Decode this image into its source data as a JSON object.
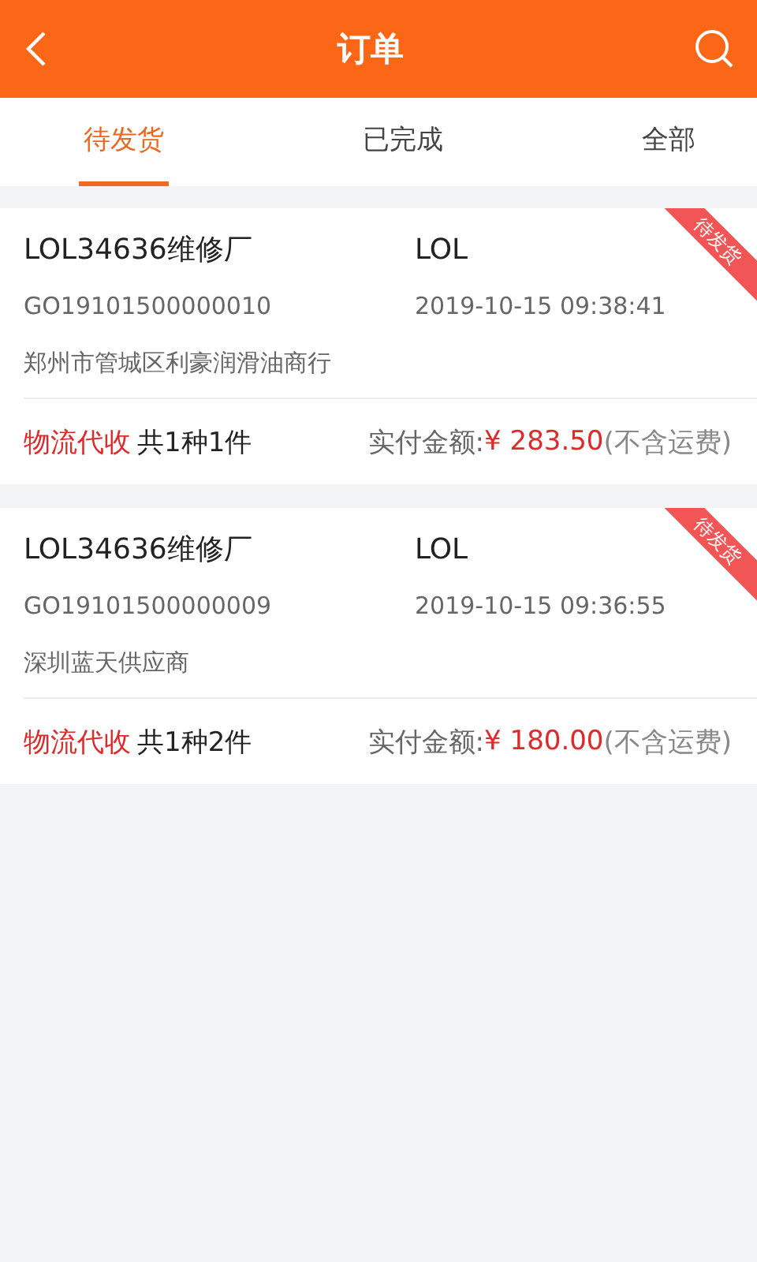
{
  "header": {
    "title": "订单"
  },
  "tabs": [
    {
      "label": "待发货",
      "selected": true
    },
    {
      "label": "已完成",
      "selected": false
    },
    {
      "label": "全部",
      "selected": false
    }
  ],
  "orders": [
    {
      "shop": "LOL34636维修厂",
      "buyer": "LOL",
      "order_no": "GO19101500000010",
      "time": "2019-10-15 09:38:41",
      "supplier": "郑州市管城区利豪润滑油商行",
      "ribbon": "待发货",
      "payment": "物流代收",
      "count": "共1种1件",
      "amount_label": "实付金额:",
      "amount": "¥ 283.50",
      "amount_note": "(不含运费)"
    },
    {
      "shop": "LOL34636维修厂",
      "buyer": "LOL",
      "order_no": "GO19101500000009",
      "time": "2019-10-15 09:36:55",
      "supplier": "深圳蓝天供应商",
      "ribbon": "待发货",
      "payment": "物流代收",
      "count": "共1种2件",
      "amount_label": "实付金额:",
      "amount": "¥ 180.00",
      "amount_note": "(不含运费)"
    }
  ]
}
